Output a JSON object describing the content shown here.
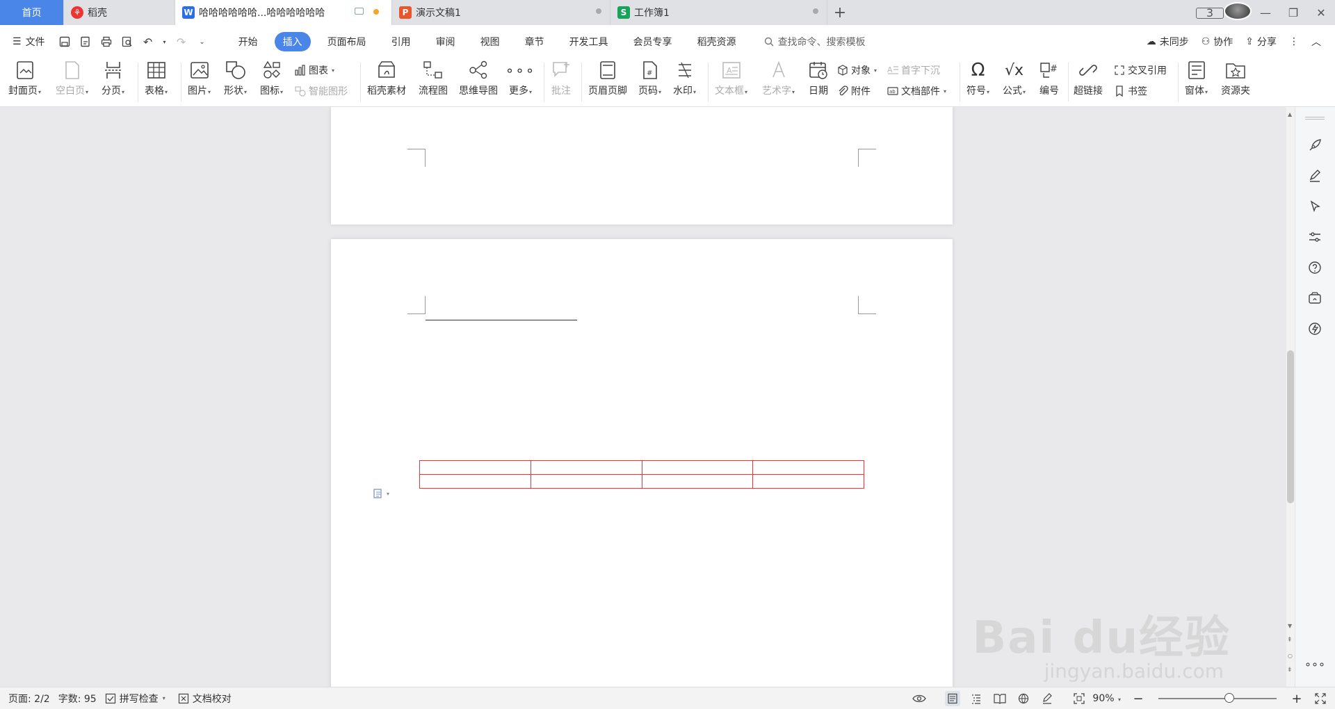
{
  "tabs": {
    "home": "首页",
    "items": [
      {
        "label": "稻壳",
        "icon": "docer-icon"
      },
      {
        "label": "哈哈哈哈哈哈...哈哈哈哈哈哈",
        "icon": "writer-icon"
      },
      {
        "label": "演示文稿1",
        "icon": "presentation-icon"
      },
      {
        "label": "工作簿1",
        "icon": "spreadsheet-icon"
      }
    ],
    "window_count": "3"
  },
  "menu": {
    "file": "文件",
    "tabs": [
      "开始",
      "插入",
      "页面布局",
      "引用",
      "审阅",
      "视图",
      "章节",
      "开发工具",
      "会员专享",
      "稻壳资源"
    ],
    "active_tab": "插入",
    "search_placeholder": "查找命令、搜索模板",
    "sync": "未同步",
    "collab": "协作",
    "share": "分享"
  },
  "ribbon": {
    "cover": "封面页",
    "blank": "空白页",
    "pagebreak": "分页",
    "table": "表格",
    "picture": "图片",
    "shape": "形状",
    "icon": "图标",
    "chart": "图表",
    "smartart": "智能图形",
    "material": "稻壳素材",
    "flowchart": "流程图",
    "mindmap": "思维导图",
    "more": "更多",
    "comment": "批注",
    "headerfooter": "页眉页脚",
    "pagenum": "页码",
    "watermark": "水印",
    "textbox": "文本框",
    "wordart": "艺术字",
    "date": "日期",
    "object": "对象",
    "attachment": "附件",
    "dropcap": "首字下沉",
    "docpart": "文档部件",
    "symbol": "符号",
    "formula": "公式",
    "numbering": "编号",
    "hyperlink": "超链接",
    "crossref": "交叉引用",
    "bookmark": "书签",
    "window": "窗体",
    "resource": "资源夹"
  },
  "status": {
    "page": "页面: 2/2",
    "words": "字数: 95",
    "spellcheck": "拼写检查",
    "proofread": "文档校对",
    "zoom": "90%",
    "zoom_level": 0.6
  },
  "watermark": {
    "brand": "Bai du经验",
    "url": "jingyan.baidu.com"
  },
  "colors": {
    "accent": "#4a86e8",
    "table_border": "#e33333"
  }
}
